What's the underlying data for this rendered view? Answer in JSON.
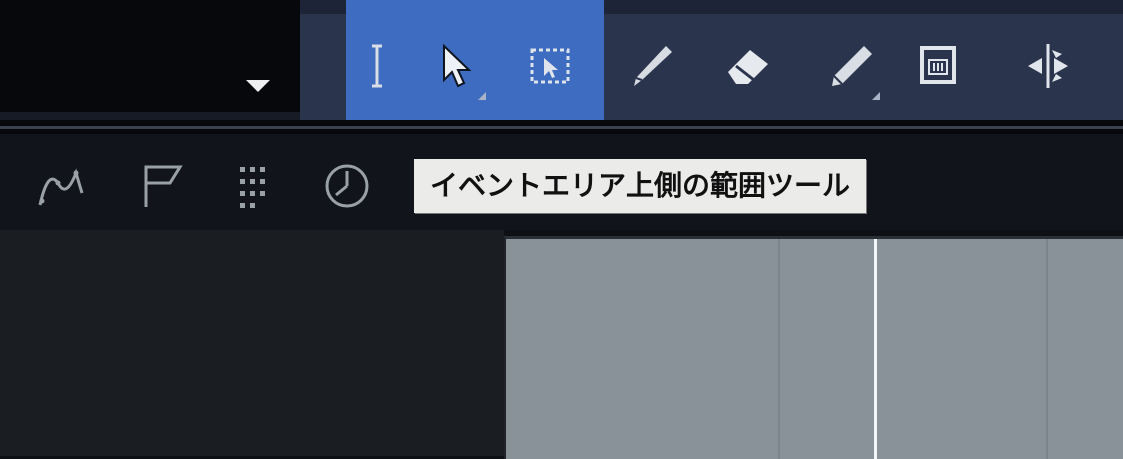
{
  "toolbar": {
    "tools": [
      {
        "name": "range-tool",
        "icon": "i-beam-icon",
        "active": true
      },
      {
        "name": "object-select-tool",
        "icon": "arrow-cursor-icon",
        "active": true
      },
      {
        "name": "range-select-tool",
        "icon": "marquee-select-icon",
        "active": true
      },
      {
        "name": "split-tool",
        "icon": "knife-icon",
        "active": false
      },
      {
        "name": "eraser-tool",
        "icon": "eraser-icon",
        "active": false
      },
      {
        "name": "draw-tool",
        "icon": "pencil-icon",
        "active": false
      },
      {
        "name": "mute-tool",
        "icon": "mute-box-icon",
        "active": false
      },
      {
        "name": "warp-tool",
        "icon": "warp-icon",
        "active": false
      }
    ]
  },
  "subtoolbar": {
    "tools": [
      {
        "name": "line-tool",
        "icon": "curve-line-icon"
      },
      {
        "name": "flag-tool",
        "icon": "flag-icon"
      },
      {
        "name": "grid-tool",
        "icon": "dot-grid-icon"
      },
      {
        "name": "time-tool",
        "icon": "clock-icon"
      }
    ]
  },
  "tooltip": {
    "text": "イベントエリア上側の範囲ツール"
  },
  "colors": {
    "active_group": "#3e6cc0",
    "toolbar": "#2a344d",
    "event_area": "#8a9299",
    "playhead": "#f4f6f8"
  }
}
